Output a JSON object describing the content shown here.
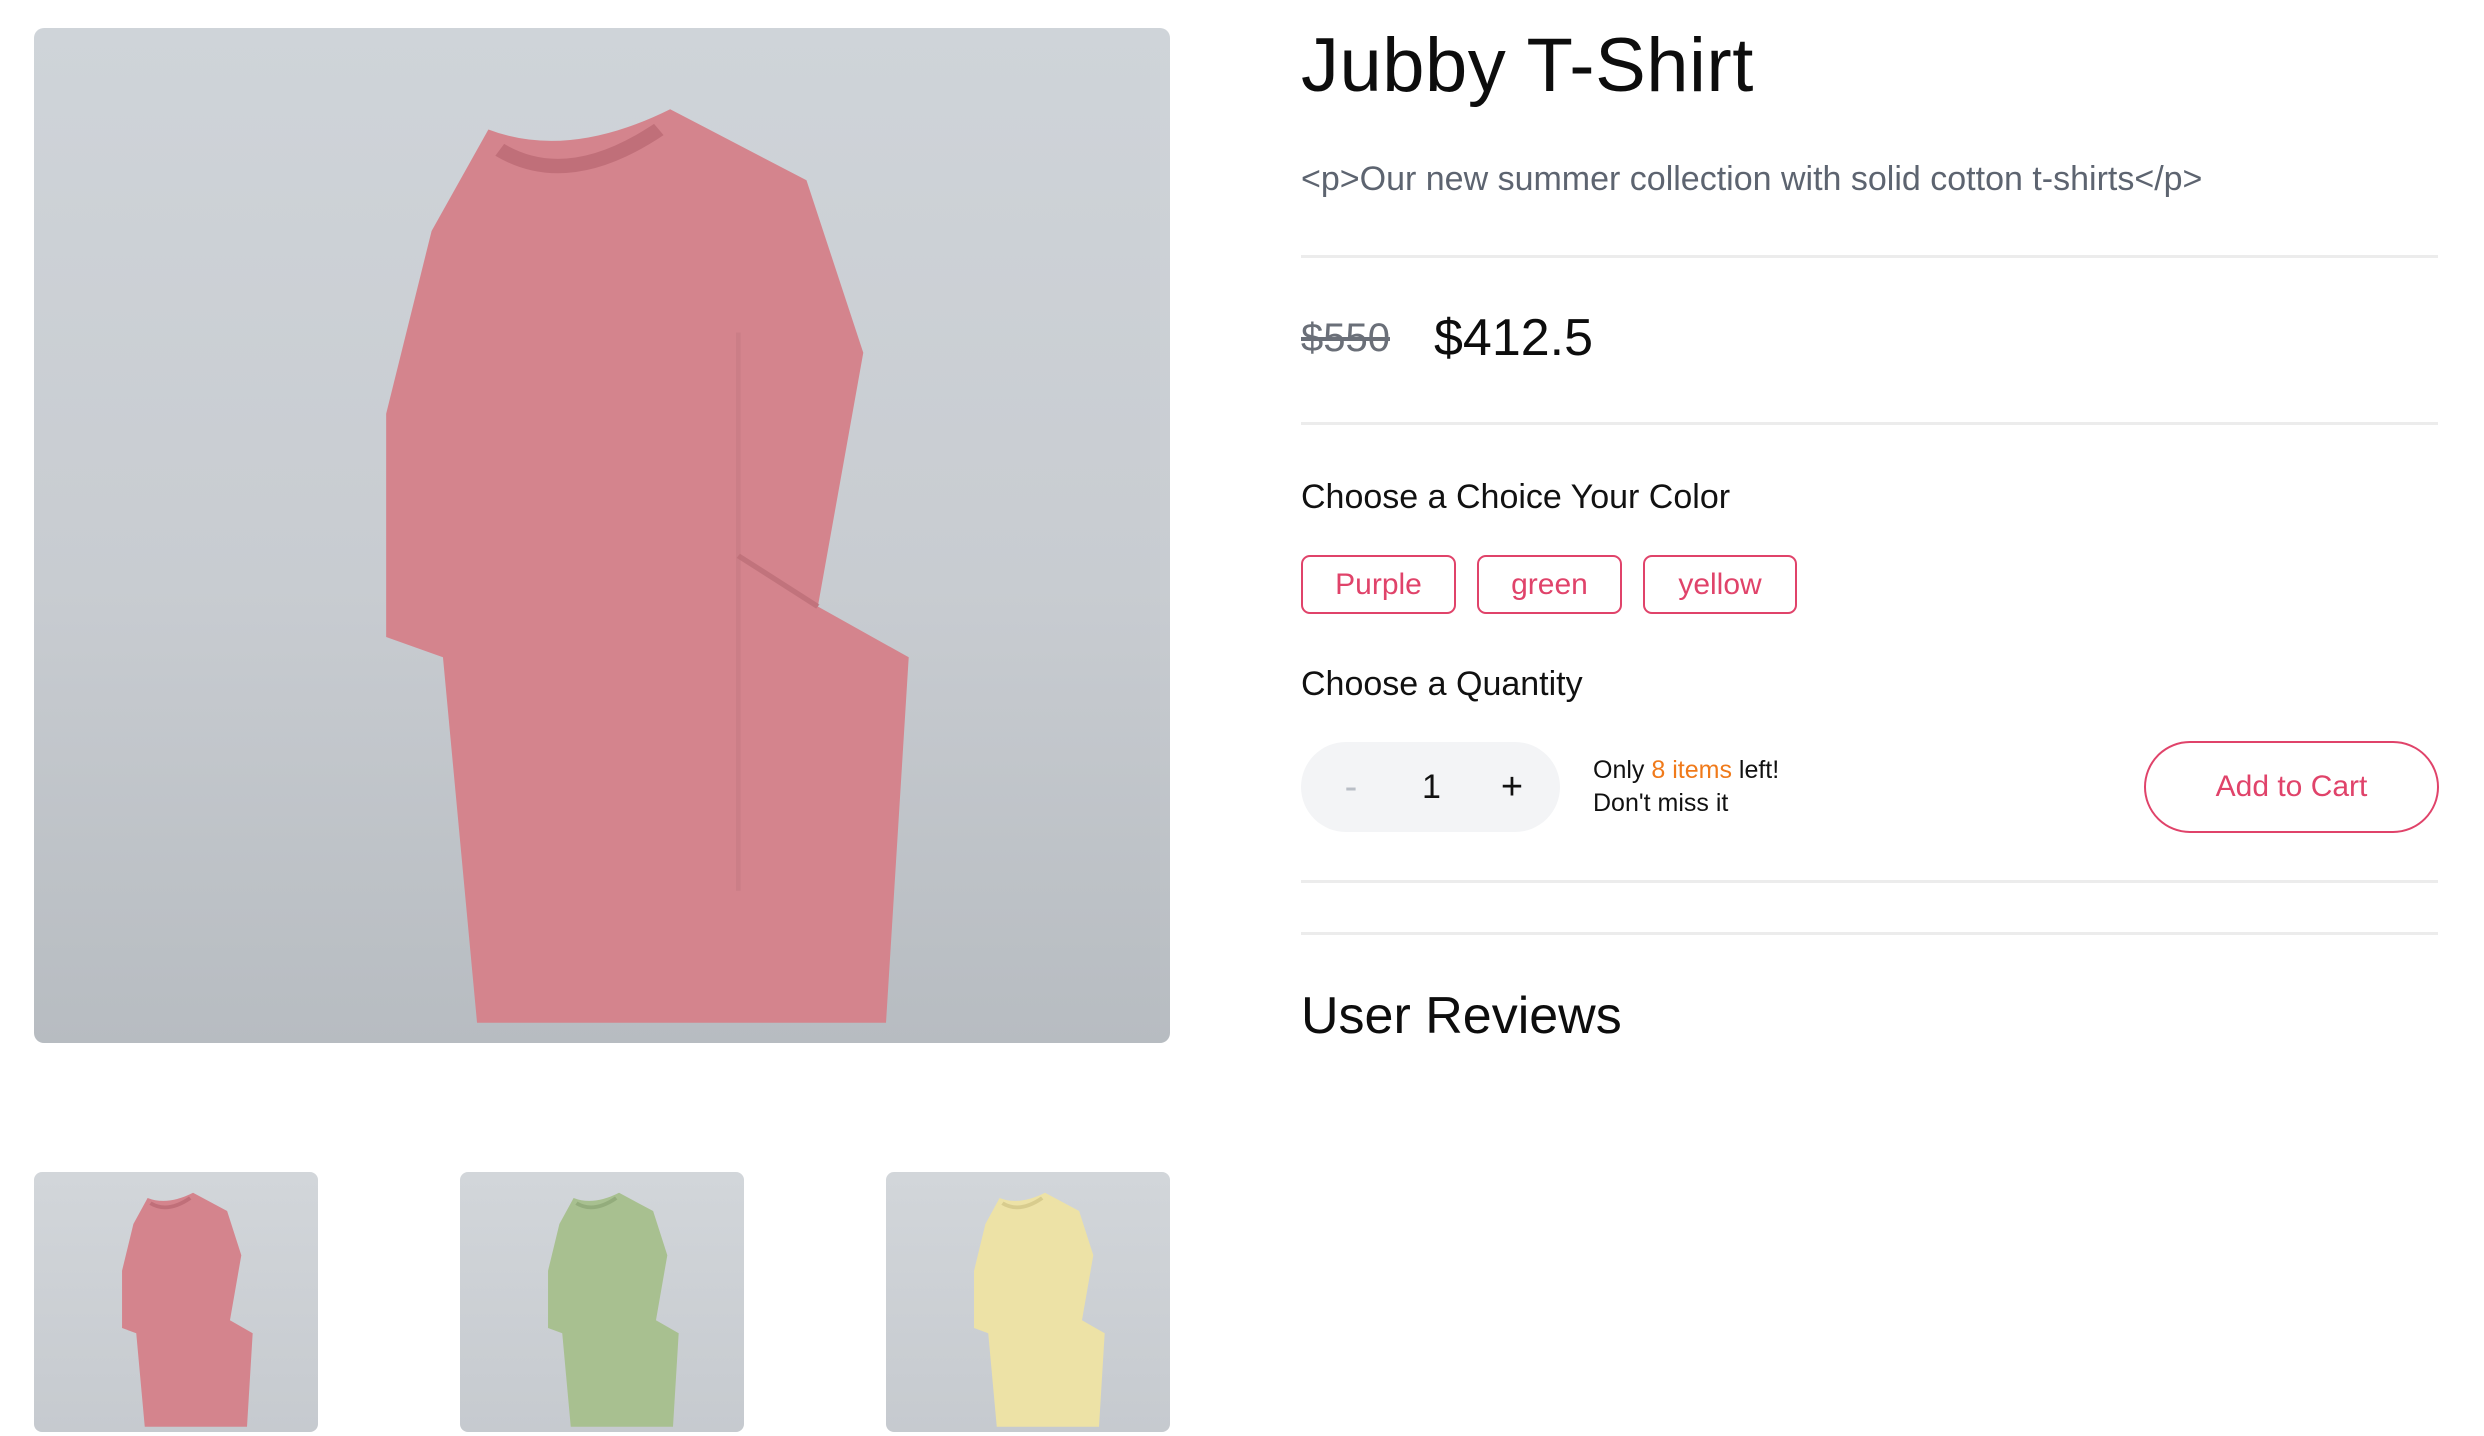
{
  "product": {
    "title": "Jubby T-Shirt",
    "description": "<p>Our new summer collection with solid cotton t-shirts</p>",
    "price_original": "$550",
    "price_current": "$412.5"
  },
  "gallery": {
    "main_color": "#d4848d",
    "thumbnails": [
      {
        "name": "pink",
        "color": "#d4848d"
      },
      {
        "name": "green",
        "color": "#a8c090"
      },
      {
        "name": "yellow",
        "color": "#ede2a6"
      }
    ]
  },
  "color_picker": {
    "label": "Choose a Choice Your Color",
    "options": [
      "Purple",
      "green",
      "yellow"
    ]
  },
  "quantity": {
    "label": "Choose a Quantity",
    "minus": "-",
    "value": "1",
    "plus": "+"
  },
  "stock": {
    "prefix": "Only ",
    "count": "8 items",
    "suffix": " left!",
    "line2": "Don't miss it"
  },
  "cart": {
    "add_label": "Add to Cart"
  },
  "reviews": {
    "title": "User Reviews"
  },
  "theme": {
    "accent": "#e0436a",
    "stock_highlight": "#f07a1a"
  }
}
